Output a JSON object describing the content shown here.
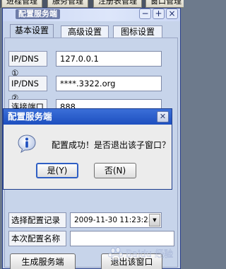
{
  "main_tabs": [
    "进程管理",
    "服务管理",
    "注册表管理",
    "窗口管理"
  ],
  "window": {
    "title": "配置服务端",
    "titlebar_buttons": [
      "minus-icon",
      "plus-icon",
      "close-icon"
    ]
  },
  "sub_tabs": [
    "基本设置",
    "高级设置",
    "图标设置"
  ],
  "fields": {
    "ip1_label": "IP/DNS ①",
    "ip1_value": "127.0.0.1",
    "ip2_label": "IP/DNS ②",
    "ip2_value": "****.3322.org",
    "port_label": "连接端口",
    "port_value": "888",
    "select_label": "选择配置记录",
    "select_value": "2009-11-30 11:23:25",
    "name_label": "本次配置名称",
    "name_value": ""
  },
  "buttons": {
    "generate": "生成服务端",
    "exit": "退出该窗口"
  },
  "dialog": {
    "title": "配置服务端",
    "message": "配置成功！是否退出该子窗口？",
    "yes": "是(Y)",
    "no": "否(N)",
    "icon": "info-icon"
  },
  "watermark": "Baidu 经验",
  "colors": {
    "window_bg": "#c7d4ea",
    "dialog_title": "#1d4fbf",
    "desktop": "#6d7a8c"
  }
}
